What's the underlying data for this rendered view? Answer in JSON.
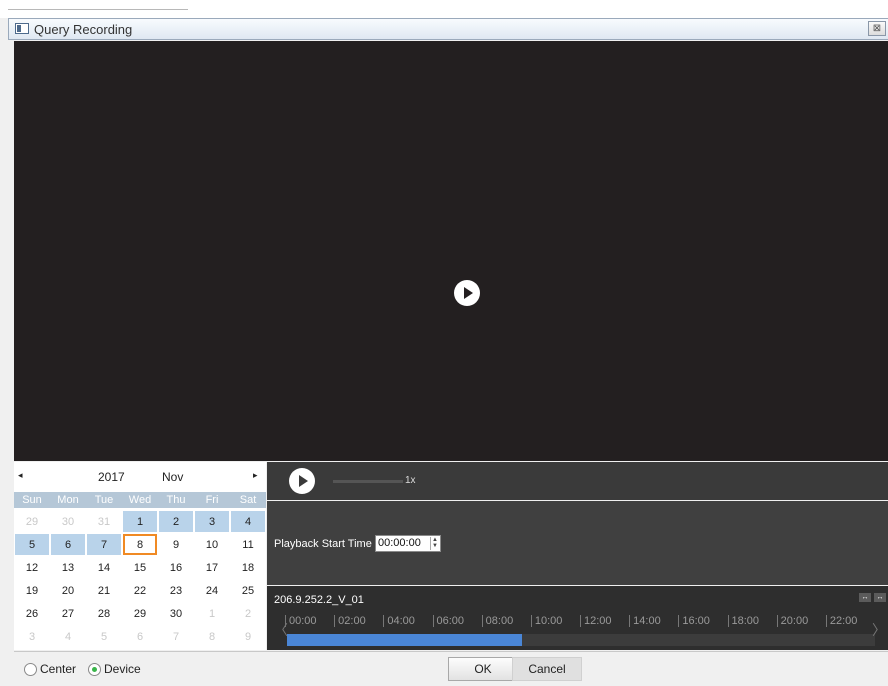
{
  "window": {
    "title": "Query Recording",
    "close_label": "⊠"
  },
  "video": {
    "play_icon": "play-icon"
  },
  "calendar": {
    "year": "2017",
    "month": "Nov",
    "prev_label": "◂",
    "next_label": "▸",
    "weekdays": [
      "Sun",
      "Mon",
      "Tue",
      "Wed",
      "Thu",
      "Fri",
      "Sat"
    ],
    "days": [
      {
        "d": "29",
        "t": "other"
      },
      {
        "d": "30",
        "t": "other"
      },
      {
        "d": "31",
        "t": "other"
      },
      {
        "d": "1",
        "t": "rec"
      },
      {
        "d": "2",
        "t": "rec"
      },
      {
        "d": "3",
        "t": "rec"
      },
      {
        "d": "4",
        "t": "rec"
      },
      {
        "d": "5",
        "t": "rec"
      },
      {
        "d": "6",
        "t": "rec"
      },
      {
        "d": "7",
        "t": "rec"
      },
      {
        "d": "8",
        "t": "sel"
      },
      {
        "d": "9",
        "t": "cur"
      },
      {
        "d": "10",
        "t": "cur"
      },
      {
        "d": "11",
        "t": "cur"
      },
      {
        "d": "12",
        "t": "cur"
      },
      {
        "d": "13",
        "t": "cur"
      },
      {
        "d": "14",
        "t": "cur"
      },
      {
        "d": "15",
        "t": "cur"
      },
      {
        "d": "16",
        "t": "cur"
      },
      {
        "d": "17",
        "t": "cur"
      },
      {
        "d": "18",
        "t": "cur"
      },
      {
        "d": "19",
        "t": "cur"
      },
      {
        "d": "20",
        "t": "cur"
      },
      {
        "d": "21",
        "t": "cur"
      },
      {
        "d": "22",
        "t": "cur"
      },
      {
        "d": "23",
        "t": "cur"
      },
      {
        "d": "24",
        "t": "cur"
      },
      {
        "d": "25",
        "t": "cur"
      },
      {
        "d": "26",
        "t": "cur"
      },
      {
        "d": "27",
        "t": "cur"
      },
      {
        "d": "28",
        "t": "cur"
      },
      {
        "d": "29",
        "t": "cur"
      },
      {
        "d": "30",
        "t": "cur"
      },
      {
        "d": "1",
        "t": "other"
      },
      {
        "d": "2",
        "t": "other"
      },
      {
        "d": "3",
        "t": "other"
      },
      {
        "d": "4",
        "t": "other"
      },
      {
        "d": "5",
        "t": "other"
      },
      {
        "d": "6",
        "t": "other"
      },
      {
        "d": "7",
        "t": "other"
      },
      {
        "d": "8",
        "t": "other"
      },
      {
        "d": "9",
        "t": "other"
      }
    ],
    "colors": {
      "recorded": "#b9d3ea",
      "selected_border": "#f08a24",
      "header": "#b5c7d7"
    }
  },
  "controls": {
    "speed": "1x"
  },
  "playback": {
    "label": "Playback Start Time",
    "start_time": "00:00:00"
  },
  "timeline": {
    "camera": "206.9.252.2_V_01",
    "ticks": [
      "00:00",
      "02:00",
      "04:00",
      "06:00",
      "08:00",
      "10:00",
      "12:00",
      "14:00",
      "16:00",
      "18:00",
      "20:00",
      "22:00"
    ],
    "recorded_fraction": 0.4,
    "recorded_color": "#4a86d6",
    "left_arrow": "〈",
    "right_arrow": "〉",
    "zoom_in_label": "↔",
    "zoom_out_label": "↔"
  },
  "footer": {
    "source_options": [
      {
        "label": "Center",
        "selected": false
      },
      {
        "label": "Device",
        "selected": true
      }
    ],
    "ok_label": "OK",
    "cancel_label": "Cancel"
  }
}
